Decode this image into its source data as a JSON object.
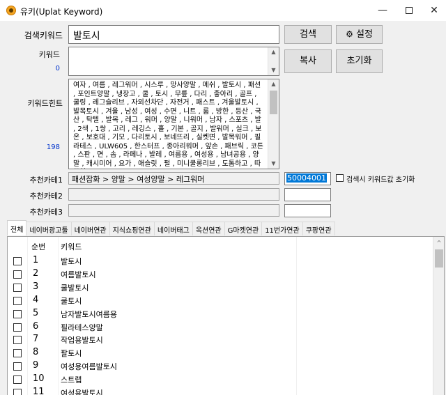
{
  "window": {
    "title": "유키(Uplat Keyword)",
    "minimize_glyph": "—",
    "close_glyph": "✕"
  },
  "search": {
    "label": "검색키워드",
    "value": "발토시",
    "search_button": "검색",
    "settings_button": "설정",
    "settings_icon": "gear-icon"
  },
  "keywords": {
    "label": "키워드",
    "count": "0",
    "copy_button": "복사",
    "reset_button": "초기화"
  },
  "hints": {
    "label": "키워드힌트",
    "count": "198",
    "text": "여자 , 여름 , 레그워머 , 시스루 , 망사양말 , 메쉬 , 발토시 , 패션 , 포인트양말 , 냉장고 , 쿨 , 토시 , 무릎 , 다리 , 좋아리 , 골프 , 쿨링 , 레그슬리브 , 자외선차단 , 자전거 , 패스트 , 겨울발토시 , 발목토시 , 겨울 , 남성 , 여성 , 수면 , 니트 , 룸 , 방한 , 등산 , 국산 , 탁텔 , 발목 , 레그 , 워머 , 양말 , 니워머 , 남자 , 스포츠 , 발 , 2색 , 1쌍 , 고리 , 레깅스 , 홀 , 기본 , 골지 , 발워머 , 실크 , 보온 , 보호대 , 기모 , 다리토시 , 보네뜨리 , 실켓면 , 발목워머 , 필라테스 , ULW605 , 한스터프 , 종아리워머 , 앞손 , 패브릭 , 코튼 , 스판 , 면 , 솜 , 라페나 , 발레 , 여름용 , 여성용 , 남녀공용 , 양말 , 캐시미어 , 요가 , 애슬릿 , 펄 , 미니쿨롱리브 , 도톰하고 , 따뜻한 , 모"
  },
  "categories": {
    "cat1_label": "추천카테1",
    "cat1_value": "패션잡화 > 양말 > 여성양말 > 레그워머",
    "cat1_code": "50004001",
    "cat2_label": "추천카테2",
    "cat3_label": "추천카테3",
    "reset_on_search_label": "검색시 키워드값 초기화"
  },
  "tabs": [
    "전체",
    "네이버광고툴",
    "네이버연관",
    "지식쇼핑연관",
    "네이버태그",
    "옥션연관",
    "G마켓연관",
    "11번가연관",
    "쿠팡연관"
  ],
  "list": {
    "col_no": "순번",
    "col_keyword": "키워드",
    "rows": [
      {
        "no": "1",
        "keyword": "발토시"
      },
      {
        "no": "2",
        "keyword": "여름발토시"
      },
      {
        "no": "3",
        "keyword": "쿨발토시"
      },
      {
        "no": "4",
        "keyword": "쿨토시"
      },
      {
        "no": "5",
        "keyword": "남자발토시여름용"
      },
      {
        "no": "6",
        "keyword": "필라테스양말"
      },
      {
        "no": "7",
        "keyword": "작업용발토시"
      },
      {
        "no": "8",
        "keyword": "팔토시"
      },
      {
        "no": "9",
        "keyword": "여성용여름발토시"
      },
      {
        "no": "10",
        "keyword": "스트랩"
      },
      {
        "no": "11",
        "keyword": "여성용발토시"
      }
    ]
  }
}
